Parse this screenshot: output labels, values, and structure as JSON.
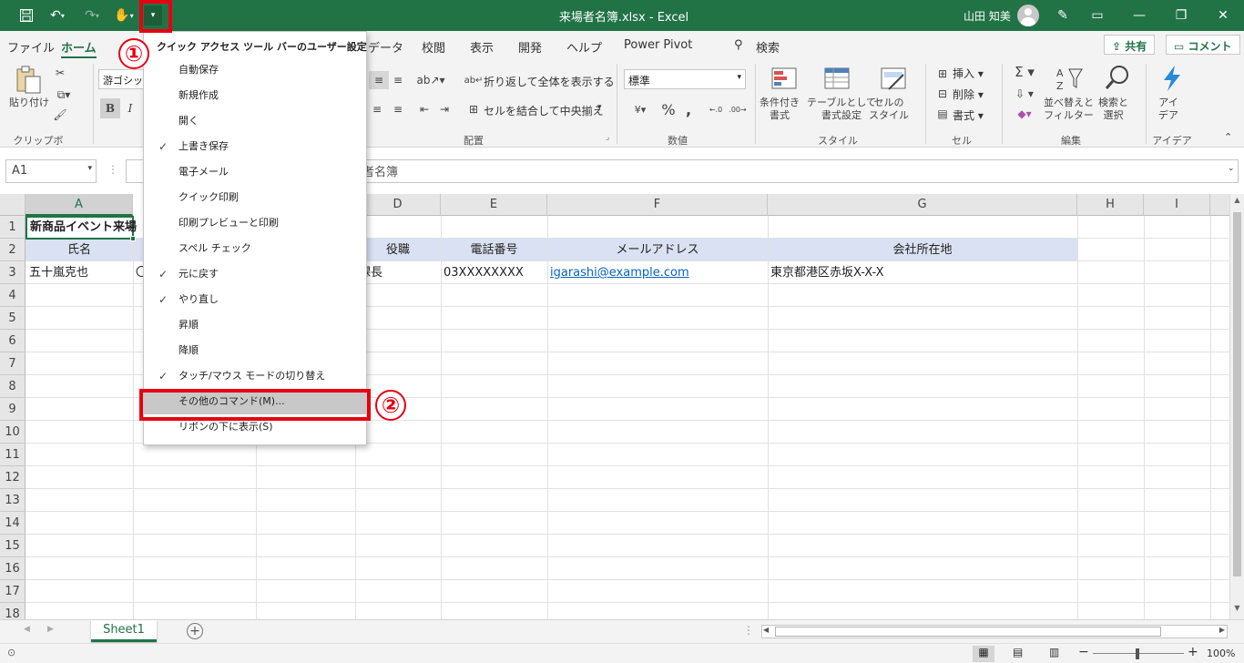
{
  "window": {
    "title": "来場者名簿.xlsx  -  Excel",
    "user": "山田 知美"
  },
  "tabs": [
    "ファイル",
    "ホーム",
    "",
    "",
    "",
    "",
    "データ",
    "校閲",
    "表示",
    "開発",
    "ヘルプ",
    "Power Pivot",
    "検索"
  ],
  "share_label": "共有",
  "comment_label": "コメント",
  "ribbon": {
    "paste": "貼り付け",
    "clipboard": "クリップボード",
    "font_name": "游ゴシック",
    "wrap_text": "折り返して全体を表示する",
    "merge_center": "セルを結合して中央揃え",
    "alignment": "配置",
    "number_format": "標準",
    "number": "数値",
    "cond_format": "条件付き\n書式",
    "table_format": "テーブルとして\n書式設定",
    "cell_style": "セルの\nスタイル",
    "styles": "スタイル",
    "insert": "挿入",
    "delete": "削除",
    "format": "書式",
    "cells": "セル",
    "sort_filter": "並べ替えと\nフィルター",
    "find_select": "検索と\n選択",
    "editing": "編集",
    "ideas": "アイ\nデア",
    "ideas_group": "アイデア"
  },
  "namebox": "A1",
  "formula_fragment": "者名簿",
  "columns": [
    "A",
    "",
    "",
    "D",
    "E",
    "F",
    "G",
    "H",
    "I"
  ],
  "rows": [
    "1",
    "2",
    "3",
    "4",
    "5",
    "6",
    "7",
    "8",
    "9",
    "10",
    "11",
    "12",
    "13",
    "14",
    "15",
    "16",
    "17",
    "18"
  ],
  "cells": {
    "a1": "新商品イベント来場",
    "a2": "氏名",
    "d2": "役職",
    "e2": "電話番号",
    "f2": "メールアドレス",
    "g2": "会社所在地",
    "a3": "五十嵐克也",
    "b3": "〇",
    "d3": "課長",
    "e3": "03XXXXXXXX",
    "f3": "igarashi@example.com",
    "g3": "東京都港区赤坂X-X-X"
  },
  "sheet_tab": "Sheet1",
  "zoom": "100%",
  "menu": {
    "title": "クイック アクセス ツール バーのユーザー設定",
    "items": [
      {
        "label": "自動保存",
        "checked": false
      },
      {
        "label": "新規作成",
        "checked": false
      },
      {
        "label": "開く",
        "checked": false
      },
      {
        "label": "上書き保存",
        "checked": true
      },
      {
        "label": "電子メール",
        "checked": false
      },
      {
        "label": "クイック印刷",
        "checked": false
      },
      {
        "label": "印刷プレビューと印刷",
        "checked": false
      },
      {
        "label": "スペル チェック",
        "checked": false
      },
      {
        "label": "元に戻す",
        "checked": true
      },
      {
        "label": "やり直し",
        "checked": true
      },
      {
        "label": "昇順",
        "checked": false
      },
      {
        "label": "降順",
        "checked": false
      },
      {
        "label": "タッチ/マウス モードの切り替え",
        "checked": true
      },
      {
        "label": "その他のコマンド(M)...",
        "checked": false
      },
      {
        "label": "リボンの下に表示(S)",
        "checked": false
      }
    ]
  },
  "annotations": {
    "step1": "①",
    "step2": "②"
  },
  "colors": {
    "excel_green": "#217346",
    "annotation_red": "#e60012",
    "header_band": "#d9e1f2"
  }
}
